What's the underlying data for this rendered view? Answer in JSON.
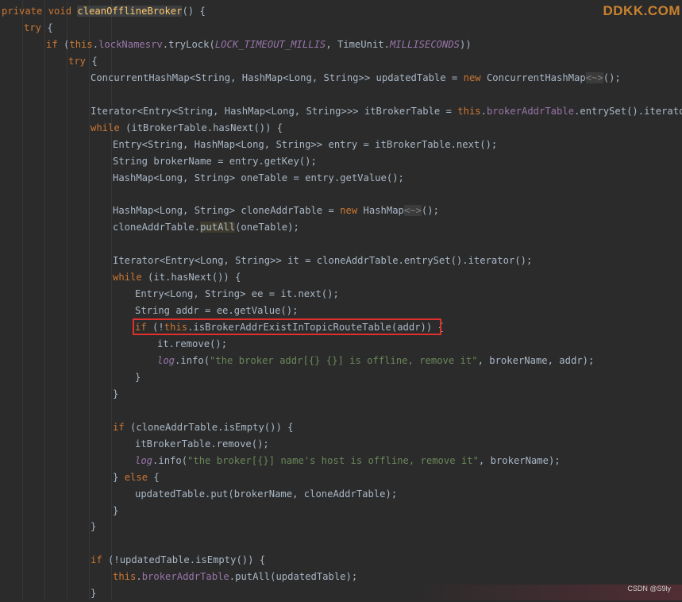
{
  "editor": {
    "watermark": "DDKK.COM",
    "corner_label": "CSDN @S9ly",
    "lines": [
      {
        "indent": 0,
        "tokens": [
          {
            "t": "private void ",
            "c": "kw"
          },
          {
            "t": "cleanOfflineBroker",
            "c": "fn hl-use"
          },
          {
            "t": "() {",
            "c": ""
          }
        ]
      },
      {
        "indent": 1,
        "tokens": [
          {
            "t": "try ",
            "c": "kw"
          },
          {
            "t": "{",
            "c": ""
          }
        ]
      },
      {
        "indent": 2,
        "tokens": [
          {
            "t": "if ",
            "c": "kw"
          },
          {
            "t": "(",
            "c": ""
          },
          {
            "t": "this",
            "c": "kw"
          },
          {
            "t": ".",
            "c": ""
          },
          {
            "t": "lockNamesrv",
            "c": "fld"
          },
          {
            "t": ".tryLock(",
            "c": ""
          },
          {
            "t": "LOCK_TIMEOUT_MILLIS",
            "c": "cst"
          },
          {
            "t": ", TimeUnit.",
            "c": ""
          },
          {
            "t": "MILLISECONDS",
            "c": "cst"
          },
          {
            "t": "))",
            "c": ""
          }
        ]
      },
      {
        "indent": 3,
        "tokens": [
          {
            "t": "try ",
            "c": "kw"
          },
          {
            "t": "{",
            "c": ""
          }
        ]
      },
      {
        "indent": 4,
        "tokens": [
          {
            "t": "ConcurrentHashMap<String, HashMap<Long, String>> updatedTable = ",
            "c": ""
          },
          {
            "t": "new ",
            "c": "kw"
          },
          {
            "t": "ConcurrentHashMap",
            "c": ""
          },
          {
            "t": "<~>",
            "c": "dim"
          },
          {
            "t": "();",
            "c": ""
          }
        ]
      },
      {
        "indent": 0,
        "tokens": []
      },
      {
        "indent": 4,
        "tokens": [
          {
            "t": "Iterator<Entry<String, HashMap<Long, String>>> itBrokerTable = ",
            "c": ""
          },
          {
            "t": "this",
            "c": "kw"
          },
          {
            "t": ".",
            "c": ""
          },
          {
            "t": "brokerAddrTable",
            "c": "fld"
          },
          {
            "t": ".entrySet().iterator();",
            "c": ""
          }
        ]
      },
      {
        "indent": 4,
        "tokens": [
          {
            "t": "while ",
            "c": "kw"
          },
          {
            "t": "(itBrokerTable.hasNext()) {",
            "c": ""
          }
        ]
      },
      {
        "indent": 5,
        "tokens": [
          {
            "t": "Entry<String, HashMap<Long, String>> entry = itBrokerTable.next();",
            "c": ""
          }
        ]
      },
      {
        "indent": 5,
        "tokens": [
          {
            "t": "String brokerName = entry.getKey();",
            "c": ""
          }
        ]
      },
      {
        "indent": 5,
        "tokens": [
          {
            "t": "HashMap<Long, String> oneTable = entry.getValue();",
            "c": ""
          }
        ]
      },
      {
        "indent": 0,
        "tokens": []
      },
      {
        "indent": 5,
        "tokens": [
          {
            "t": "HashMap<Long, String> cloneAddrTable = ",
            "c": ""
          },
          {
            "t": "new ",
            "c": "kw"
          },
          {
            "t": "HashMap",
            "c": ""
          },
          {
            "t": "<~>",
            "c": "dim"
          },
          {
            "t": "();",
            "c": ""
          }
        ]
      },
      {
        "indent": 5,
        "tokens": [
          {
            "t": "cloneAddrTable.",
            "c": ""
          },
          {
            "t": "putAll",
            "c": "hl-warn"
          },
          {
            "t": "(oneTable);",
            "c": ""
          }
        ]
      },
      {
        "indent": 0,
        "tokens": []
      },
      {
        "indent": 5,
        "tokens": [
          {
            "t": "Iterator<Entry<Long, String>> it = cloneAddrTable.entrySet().iterator();",
            "c": ""
          }
        ]
      },
      {
        "indent": 5,
        "tokens": [
          {
            "t": "while ",
            "c": "kw"
          },
          {
            "t": "(it.hasNext()) {",
            "c": ""
          }
        ]
      },
      {
        "indent": 6,
        "tokens": [
          {
            "t": "Entry<Long, String> ee = it.next();",
            "c": ""
          }
        ]
      },
      {
        "indent": 6,
        "tokens": [
          {
            "t": "String addr = ee.getValue();",
            "c": ""
          }
        ]
      },
      {
        "indent": 6,
        "tokens": [
          {
            "t": "if ",
            "c": "kw"
          },
          {
            "t": "(!",
            "c": ""
          },
          {
            "t": "this",
            "c": "kw"
          },
          {
            "t": ".isBrokerAddrExistInTopicRouteTable(addr)) {",
            "c": ""
          }
        ]
      },
      {
        "indent": 7,
        "tokens": [
          {
            "t": "it.remove();",
            "c": ""
          }
        ]
      },
      {
        "indent": 7,
        "tokens": [
          {
            "t": "log",
            "c": "stat"
          },
          {
            "t": ".info(",
            "c": ""
          },
          {
            "t": "\"the broker addr[{} {}] is offline, remove it\"",
            "c": "str"
          },
          {
            "t": ", brokerName, addr);",
            "c": ""
          }
        ]
      },
      {
        "indent": 6,
        "tokens": [
          {
            "t": "}",
            "c": ""
          }
        ]
      },
      {
        "indent": 5,
        "tokens": [
          {
            "t": "}",
            "c": ""
          }
        ]
      },
      {
        "indent": 0,
        "tokens": []
      },
      {
        "indent": 5,
        "tokens": [
          {
            "t": "if ",
            "c": "kw"
          },
          {
            "t": "(cloneAddrTable.isEmpty()) {",
            "c": ""
          }
        ]
      },
      {
        "indent": 6,
        "tokens": [
          {
            "t": "itBrokerTable.remove();",
            "c": ""
          }
        ]
      },
      {
        "indent": 6,
        "tokens": [
          {
            "t": "log",
            "c": "stat"
          },
          {
            "t": ".info(",
            "c": ""
          },
          {
            "t": "\"the broker[{}] name's host is offline, remove it\"",
            "c": "str"
          },
          {
            "t": ", brokerName);",
            "c": ""
          }
        ]
      },
      {
        "indent": 5,
        "tokens": [
          {
            "t": "} ",
            "c": ""
          },
          {
            "t": "else ",
            "c": "kw"
          },
          {
            "t": "{",
            "c": ""
          }
        ]
      },
      {
        "indent": 6,
        "tokens": [
          {
            "t": "updatedTable.put(brokerName, cloneAddrTable);",
            "c": ""
          }
        ]
      },
      {
        "indent": 5,
        "tokens": [
          {
            "t": "}",
            "c": ""
          }
        ]
      },
      {
        "indent": 4,
        "tokens": [
          {
            "t": "}",
            "c": ""
          }
        ]
      },
      {
        "indent": 0,
        "tokens": []
      },
      {
        "indent": 4,
        "tokens": [
          {
            "t": "if ",
            "c": "kw"
          },
          {
            "t": "(!updatedTable.isEmpty()) {",
            "c": ""
          }
        ]
      },
      {
        "indent": 5,
        "tokens": [
          {
            "t": "this",
            "c": "kw"
          },
          {
            "t": ".",
            "c": ""
          },
          {
            "t": "brokerAddrTable",
            "c": "fld"
          },
          {
            "t": ".putAll(updatedTable);",
            "c": ""
          }
        ]
      },
      {
        "indent": 4,
        "tokens": [
          {
            "t": "}",
            "c": ""
          }
        ]
      }
    ]
  }
}
